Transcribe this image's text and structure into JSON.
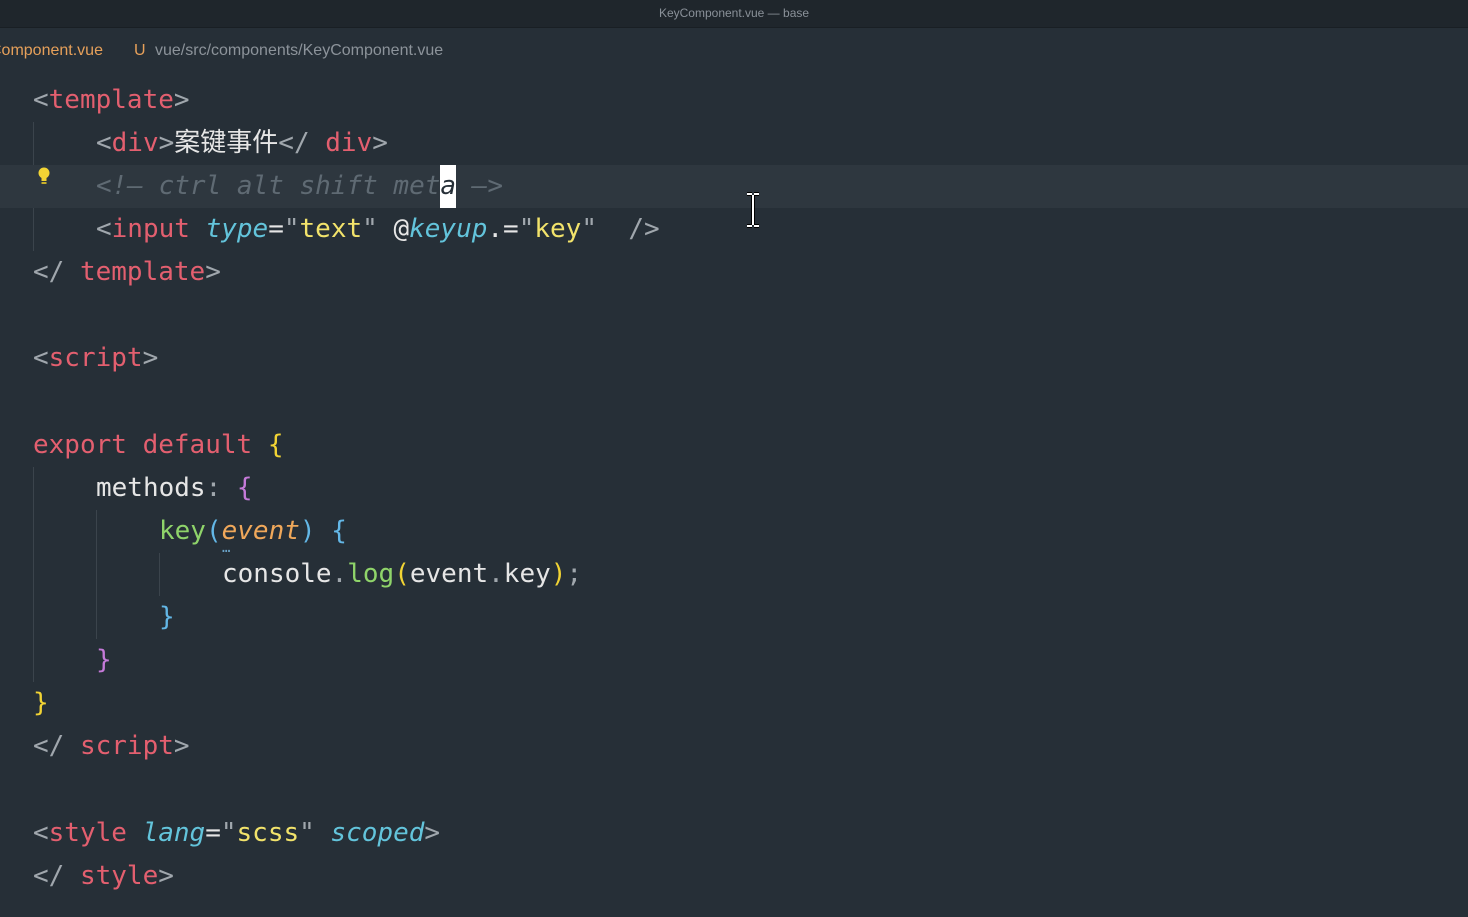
{
  "window": {
    "title": "KeyComponent.vue — base"
  },
  "breadcrumb": {
    "file": "Component.vue",
    "status": "U",
    "path": "vue/src/components/KeyComponent.vue"
  },
  "code": {
    "l1": {
      "open": "<",
      "tag": "template",
      "close": ">"
    },
    "l2": {
      "open": "<",
      "tag": "div",
      "close": ">",
      "text": "案键事件",
      "end_open": "</",
      "end_tag": " div",
      "end_close": ">"
    },
    "l3": {
      "comment": "<!— ctrl alt shift met",
      "cursor_char": "a",
      "comment_end": " —>"
    },
    "l4": {
      "open": "<",
      "tag": "input",
      "attr1": "type",
      "eq1": "=",
      "q1": "\"",
      "val1": "text",
      "q1b": "\"",
      "at": "@",
      "attr2": "keyup",
      "mod": ".=",
      "q2": "\"",
      "val2": "key",
      "q2b": "\"",
      "selfclose": "/>"
    },
    "l5": {
      "open": "</",
      "tag": " template",
      "close": ">"
    },
    "l7": {
      "open": "<",
      "tag": "script",
      "close": ">"
    },
    "l9": {
      "kw1": "export",
      "kw2": "default",
      "brace": "{"
    },
    "l10": {
      "name": "methods",
      "colon": ":",
      "brace": "{"
    },
    "l11": {
      "fn": "key",
      "lp": "(",
      "param": "event",
      "rp": ")",
      "brace": "{"
    },
    "l12": {
      "obj": "console",
      "dot1": ".",
      "method": "log",
      "lp": "(",
      "arg": "event",
      "dot2": ".",
      "prop": "key",
      "rp": ")",
      "semi": ";"
    },
    "l13": {
      "brace": "}"
    },
    "l14": {
      "brace": "}"
    },
    "l15": {
      "brace": "}"
    },
    "l16": {
      "open": "</",
      "tag": " script",
      "close": ">"
    },
    "l18": {
      "open": "<",
      "tag": "style",
      "attr1": "lang",
      "eq": "=",
      "q": "\"",
      "val": "scss",
      "qb": "\"",
      "attr2": "scoped",
      "close": ">"
    },
    "l19": {
      "open": "</",
      "tag": " style",
      "close": ">"
    }
  },
  "colors": {
    "background": "#262f37",
    "tag": "#e35f6f",
    "attribute": "#63c4db",
    "string": "#f2e36b",
    "function": "#8fd46a",
    "parameter": "#f0a85a",
    "comment": "#5f6a73",
    "breadcrumb_file": "#e6a05a"
  }
}
